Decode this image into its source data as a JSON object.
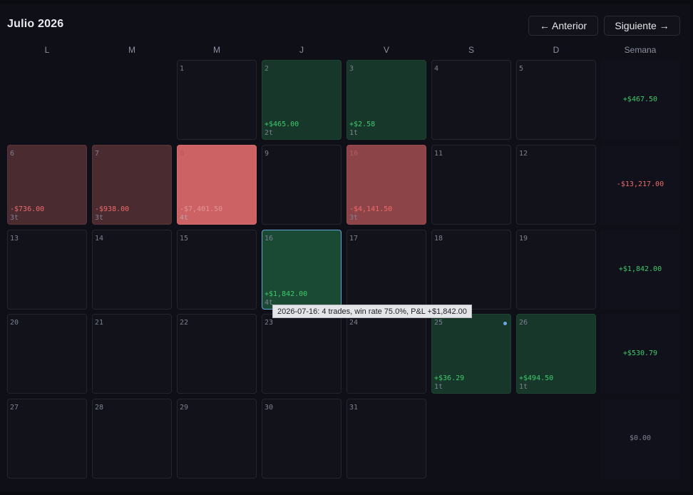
{
  "calendar": {
    "title": "Julio 2026",
    "prev_label": "← Anterior",
    "next_label": "Siguiente →",
    "weekdays": [
      "L",
      "M",
      "M",
      "J",
      "V",
      "S",
      "D"
    ],
    "week_header": "Semana",
    "days": {
      "d1": {
        "num": "1"
      },
      "d2": {
        "num": "2",
        "pnl": "+$465.00",
        "trades": "2t"
      },
      "d3": {
        "num": "3",
        "pnl": "+$2.58",
        "trades": "1t"
      },
      "d4": {
        "num": "4"
      },
      "d5": {
        "num": "5"
      },
      "d6": {
        "num": "6",
        "pnl": "-$736.00",
        "trades": "3t"
      },
      "d7": {
        "num": "7",
        "pnl": "-$938.00",
        "trades": "3t"
      },
      "d8": {
        "num": "8",
        "pnl": "-$7,401.50",
        "trades": "4t"
      },
      "d9": {
        "num": "9"
      },
      "d10": {
        "num": "10",
        "pnl": "-$4,141.50",
        "trades": "3t"
      },
      "d11": {
        "num": "11"
      },
      "d12": {
        "num": "12"
      },
      "d13": {
        "num": "13"
      },
      "d14": {
        "num": "14"
      },
      "d15": {
        "num": "15"
      },
      "d16": {
        "num": "16",
        "pnl": "+$1,842.00",
        "trades": "4t"
      },
      "d17": {
        "num": "17"
      },
      "d18": {
        "num": "18"
      },
      "d19": {
        "num": "19"
      },
      "d20": {
        "num": "20"
      },
      "d21": {
        "num": "21"
      },
      "d22": {
        "num": "22"
      },
      "d23": {
        "num": "23"
      },
      "d24": {
        "num": "24"
      },
      "d25": {
        "num": "25",
        "pnl": "+$36.29",
        "trades": "1t"
      },
      "d26": {
        "num": "26",
        "pnl": "+$494.50",
        "trades": "1t"
      },
      "d27": {
        "num": "27"
      },
      "d28": {
        "num": "28"
      },
      "d29": {
        "num": "29"
      },
      "d30": {
        "num": "30"
      },
      "d31": {
        "num": "31"
      }
    },
    "weeks": [
      "+$467.50",
      "-$13,217.00",
      "+$1,842.00",
      "+$530.79",
      "$0.00"
    ],
    "tooltip": "2026-07-16: 4 trades, win rate 75.0%, P&L +$1,842.00"
  },
  "colors": {
    "profit": "#3fca6c",
    "loss": "#ef6b6b",
    "selected_border": "#63a9d8",
    "marker": "#6aa7e6"
  }
}
